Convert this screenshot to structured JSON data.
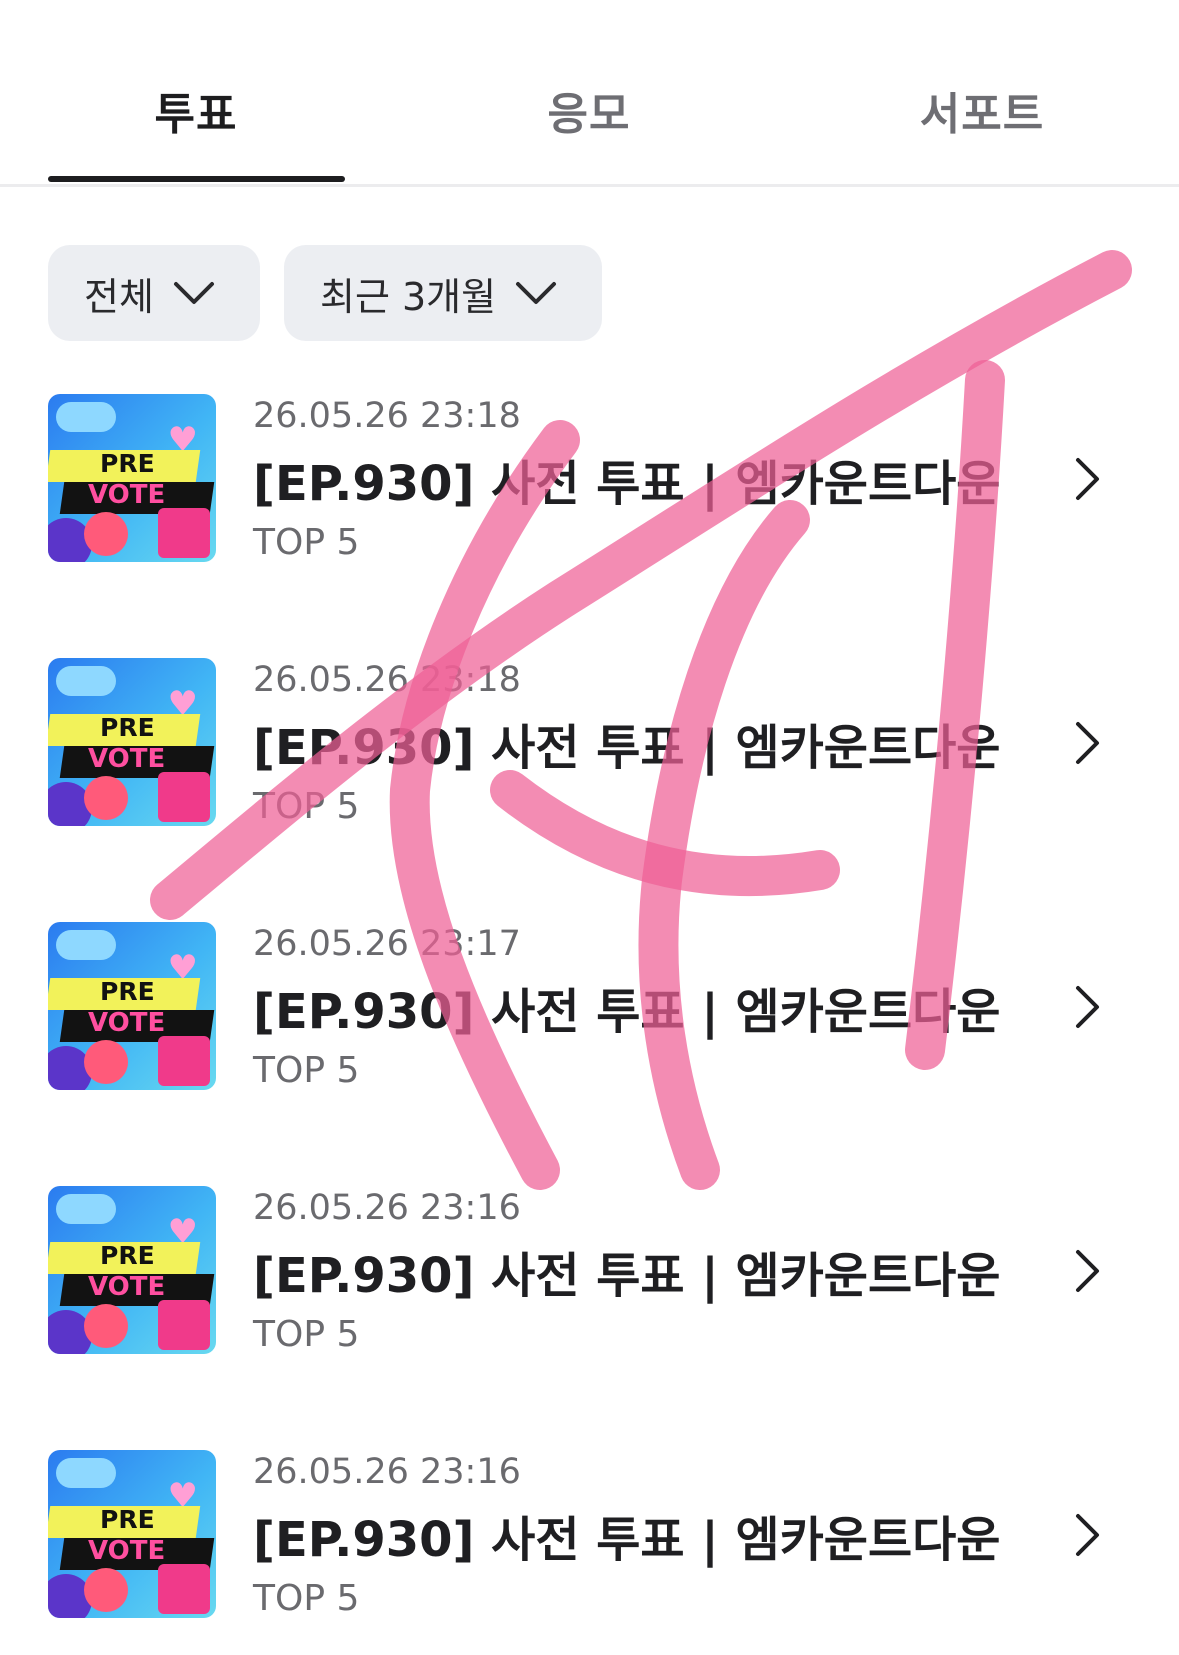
{
  "tabs": [
    {
      "label": "투표",
      "active": true
    },
    {
      "label": "응모",
      "active": false
    },
    {
      "label": "서포트",
      "active": false
    }
  ],
  "filters": {
    "category": "전체",
    "period": "최근 3개월"
  },
  "items": [
    {
      "date": "26.05.26 23:18",
      "title": "[EP.930] 사전 투표 | 엠카운트다운",
      "subtitle": "TOP 5",
      "thumb_top": "PRE",
      "thumb_bottom": "VOTE"
    },
    {
      "date": "26.05.26 23:18",
      "title": "[EP.930] 사전 투표 | 엠카운트다운",
      "subtitle": "TOP 5",
      "thumb_top": "PRE",
      "thumb_bottom": "VOTE"
    },
    {
      "date": "26.05.26 23:17",
      "title": "[EP.930] 사전 투표 | 엠카운트다운",
      "subtitle": "TOP 5",
      "thumb_top": "PRE",
      "thumb_bottom": "VOTE"
    },
    {
      "date": "26.05.26 23:16",
      "title": "[EP.930] 사전 투표 | 엠카운트다운",
      "subtitle": "TOP 5",
      "thumb_top": "PRE",
      "thumb_bottom": "VOTE"
    },
    {
      "date": "26.05.26 23:16",
      "title": "[EP.930] 사전 투표 | 엠카운트다운",
      "subtitle": "TOP 5",
      "thumb_top": "PRE",
      "thumb_bottom": "VOTE"
    }
  ],
  "overlay": {
    "color": "#ef5f95"
  }
}
